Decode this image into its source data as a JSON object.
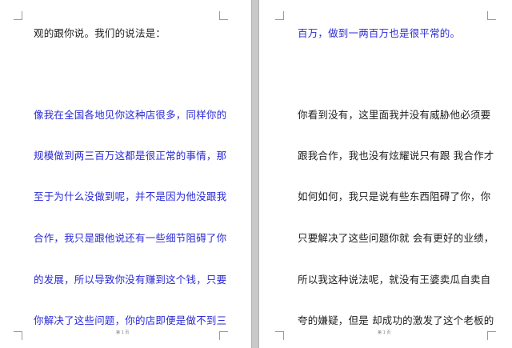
{
  "pages": [
    {
      "lines": [
        {
          "text": "观的跟你说。我们的说法是：",
          "color": "#1c1c1c"
        },
        {
          "text": "像我在全国各地见你这种店很多，同样你的",
          "color": "#2b2bd6"
        },
        {
          "text": "规模做到两三百万这都是很正常的事情，那",
          "color": "#2b2bd6"
        },
        {
          "text": "至于为什么没做到呢，并不是因为他没跟我",
          "color": "#2b2bd6"
        },
        {
          "text": "合作，我只是跟他说还有一些细节阻碍了你",
          "color": "#2b2bd6"
        },
        {
          "text": "的发展，所以导致你没有赚到这个钱，只要",
          "color": "#2b2bd6"
        },
        {
          "text": "你解决了这些问题，你的店即便是做不到三",
          "color": "#2b2bd6"
        }
      ],
      "footer": "第 1 页"
    },
    {
      "lines": [
        {
          "text": "百万，做到一两百万也是很平常的。",
          "color": "#2b2bd6"
        },
        {
          "text": "你看到没有，这里面我并没有威胁他必须要",
          "color": "#1c1c1c"
        },
        {
          "text": "跟我合作，我也没有炫耀说只有跟 我合作才",
          "color": "#1c1c1c"
        },
        {
          "text": "如何如何，我只是说有些东西阻碍了你，你",
          "color": "#1c1c1c"
        },
        {
          "text": "只要解决了这些问题你就 会有更好的业绩，",
          "color": "#1c1c1c"
        },
        {
          "text": "所以我这种说法呢，就没有王婆卖瓜自卖自",
          "color": "#1c1c1c"
        },
        {
          "text": "夸的嫌疑，但是 却成功的激发了这个老板的",
          "color": "#1c1c1c"
        }
      ],
      "footer": "第 1 页"
    }
  ]
}
